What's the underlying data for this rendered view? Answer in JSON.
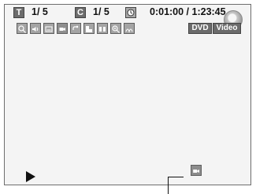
{
  "title_indicator": {
    "label": "T",
    "value": "1/ 5"
  },
  "chapter_indicator": {
    "label": "C",
    "value": "1/ 5"
  },
  "time_indicator": {
    "icon": "clock-icon",
    "value": "0:01:00 / 1:23:45"
  },
  "disc_icon": "disc-icon",
  "setting_icons": [
    "search-icon",
    "audio-icon",
    "subtitle-icon",
    "angle-icon",
    "repeat-icon",
    "marker-icon",
    "noise-reduction-icon",
    "zoom-icon",
    "sound-mode-icon"
  ],
  "media_type": {
    "disc": "DVD",
    "mode": "Video"
  },
  "playback_icon": "play-icon",
  "angle_mark_icon": "angle-mark-icon"
}
